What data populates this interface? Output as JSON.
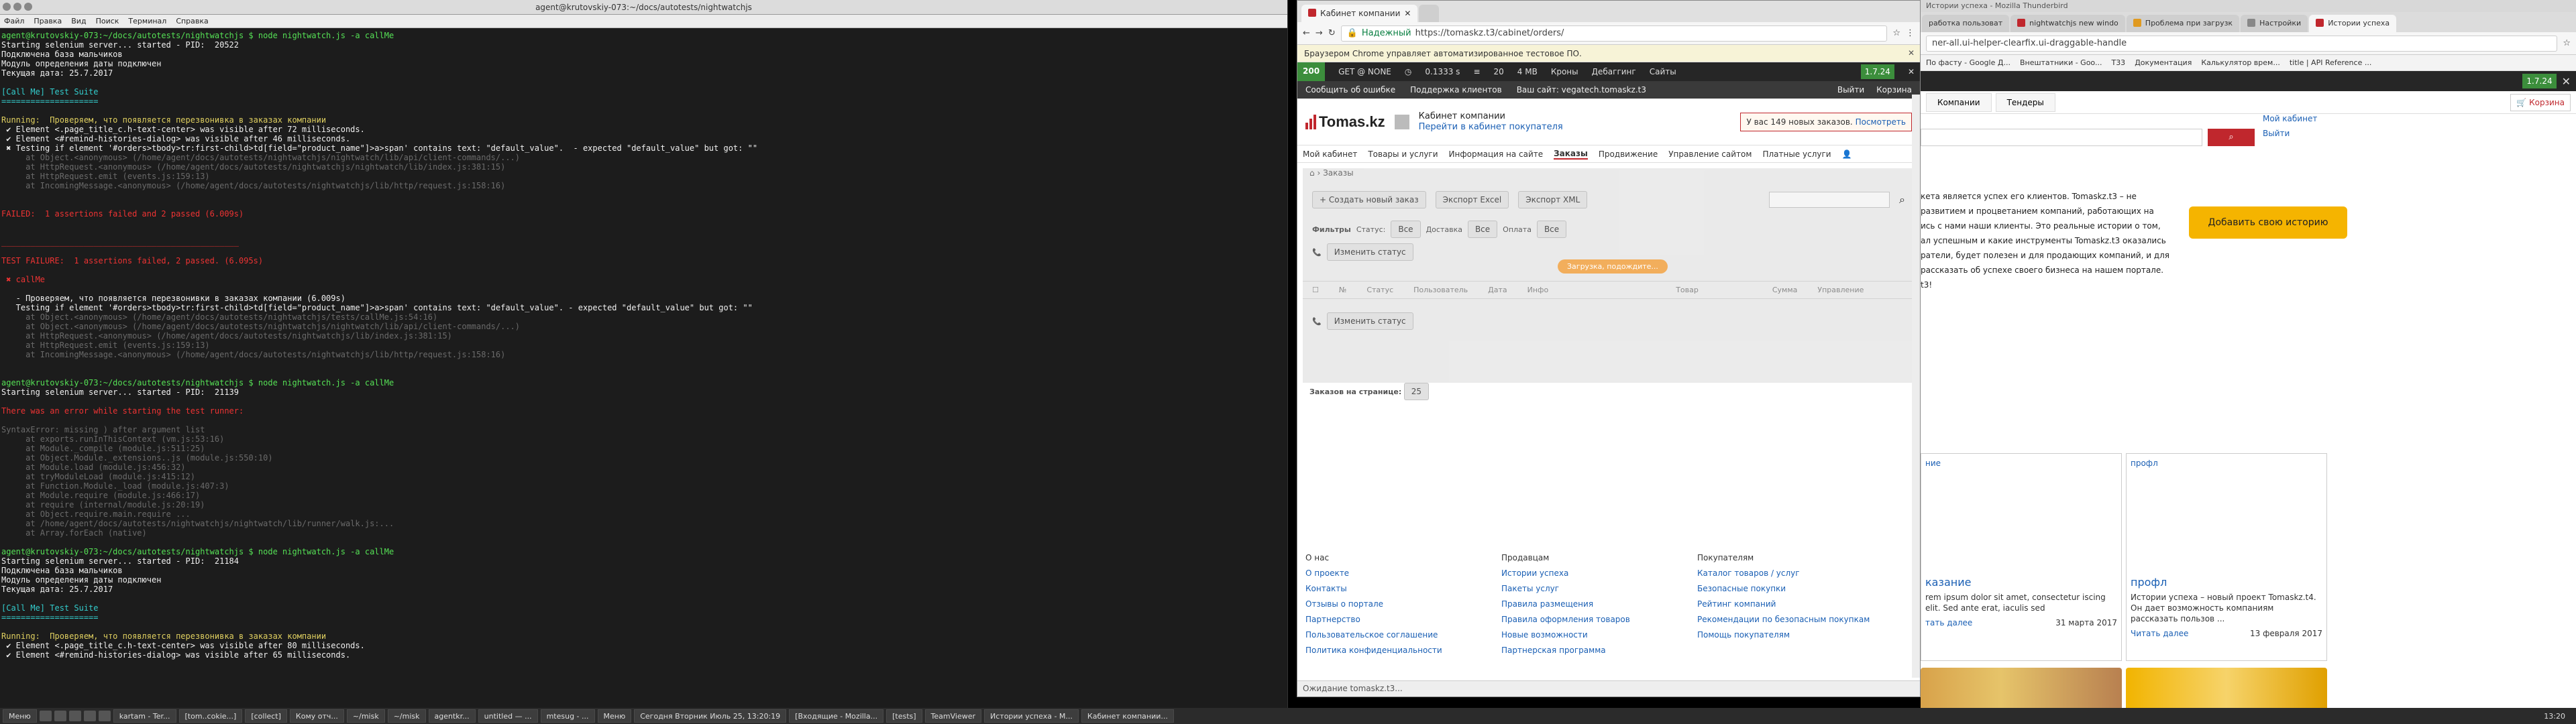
{
  "terminal": {
    "title": "agent@krutovskiy-073:~/docs/autotests/nightwatchjs",
    "menu": [
      "Файл",
      "Правка",
      "Вид",
      "Поиск",
      "Терминал",
      "Справка"
    ],
    "lines": [
      {
        "t": "agent@krutovskiy-073:~/docs/autotests/nightwatchjs $ node nightwatch.js -a callMe",
        "c": "cg"
      },
      {
        "t": "Starting selenium server... started - PID:  20522",
        "c": "cw"
      },
      {
        "t": "Подключена база мальчиков",
        "c": "cw"
      },
      {
        "t": "Модуль определения даты подключен",
        "c": "cw"
      },
      {
        "t": "Текущая дата: 25.7.2017",
        "c": "cw"
      },
      {
        "t": "",
        "c": "cw"
      },
      {
        "t": "[Call Me] Test Suite",
        "c": "cc"
      },
      {
        "t": "====================",
        "c": "cc"
      },
      {
        "t": "",
        "c": "cw"
      },
      {
        "t": "Running:  Проверяем, что появляется перезвонивка в заказах компании",
        "c": "cy"
      },
      {
        "t": " ✔ Element <.page_title_c.h-text-center> was visible after 72 milliseconds.",
        "c": "cw"
      },
      {
        "t": " ✔ Element <#remind-histories-dialog> was visible after 46 milliseconds.",
        "c": "cw"
      },
      {
        "t": " ✖ Testing if element '#orders>tbody>tr:first-child>td[field=\"product_name\"]>a>span' contains text: \"default_value\".  - expected \"default_value\" but got: \"\"",
        "c": "cw"
      },
      {
        "t": "     at Object.<anonymous> (/home/agent/docs/autotests/nightwatchjs/nightwatch/lib/api/client-commands/...)",
        "c": "cd"
      },
      {
        "t": "     at HttpRequest.<anonymous> (/home/agent/docs/autotests/nightwatchjs/nightwatch/lib/index.js:381:15)",
        "c": "cd"
      },
      {
        "t": "     at HttpRequest.emit (events.js:159:13)",
        "c": "cd"
      },
      {
        "t": "     at IncomingMessage.<anonymous> (/home/agent/docs/autotests/nightwatchjs/lib/http/request.js:158:16)",
        "c": "cd"
      },
      {
        "t": "",
        "c": "cw"
      },
      {
        "t": "",
        "c": "cw"
      },
      {
        "t": "FAILED:  1 assertions failed and 2 passed (6.009s)",
        "c": "cr"
      },
      {
        "t": "",
        "c": "cw"
      },
      {
        "t": "",
        "c": "cw"
      },
      {
        "t": "_________________________________________________",
        "c": "cr"
      },
      {
        "t": "",
        "c": "cw"
      },
      {
        "t": "TEST FAILURE:  1 assertions failed, 2 passed. (6.095s)",
        "c": "cr"
      },
      {
        "t": "",
        "c": "cw"
      },
      {
        "t": " ✖ callMe",
        "c": "cr"
      },
      {
        "t": "",
        "c": "cw"
      },
      {
        "t": "   - Проверяем, что появляется перезвонивки в заказах компании (6.009s)",
        "c": "cw"
      },
      {
        "t": "   Testing if element '#orders>tbody>tr:first-child>td[field=\"product_name\"]>a>span' contains text: \"default_value\". - expected \"default_value\" but got: \"\"",
        "c": "cw"
      },
      {
        "t": "     at Object.<anonymous> (/home/agent/docs/autotests/nightwatchjs/tests/callMe.js:54:16)",
        "c": "cd"
      },
      {
        "t": "     at Object.<anonymous> (/home/agent/docs/autotests/nightwatchjs/nightwatch/lib/api/client-commands/...)",
        "c": "cd"
      },
      {
        "t": "     at HttpRequest.<anonymous> (/home/agent/docs/autotests/nightwatchjs/lib/index.js:381:15)",
        "c": "cd"
      },
      {
        "t": "     at HttpRequest.emit (events.js:159:13)",
        "c": "cd"
      },
      {
        "t": "     at IncomingMessage.<anonymous> (/home/agent/docs/autotests/nightwatchjs/lib/http/request.js:158:16)",
        "c": "cd"
      },
      {
        "t": "",
        "c": "cw"
      },
      {
        "t": "",
        "c": "cw"
      },
      {
        "t": "agent@krutovskiy-073:~/docs/autotests/nightwatchjs $ node nightwatch.js -a callMe",
        "c": "cg"
      },
      {
        "t": "Starting selenium server... started - PID:  21139",
        "c": "cw"
      },
      {
        "t": "",
        "c": "cw"
      },
      {
        "t": "There was an error while starting the test runner:",
        "c": "cr"
      },
      {
        "t": "",
        "c": "cw"
      },
      {
        "t": "SyntaxError: missing ) after argument list",
        "c": "cd"
      },
      {
        "t": "     at exports.runInThisContext (vm.js:53:16)",
        "c": "cd"
      },
      {
        "t": "     at Module._compile (module.js:511:25)",
        "c": "cd"
      },
      {
        "t": "     at Object.Module._extensions..js (module.js:550:10)",
        "c": "cd"
      },
      {
        "t": "     at Module.load (module.js:456:32)",
        "c": "cd"
      },
      {
        "t": "     at tryModuleLoad (module.js:415:12)",
        "c": "cd"
      },
      {
        "t": "     at Function.Module._load (module.js:407:3)",
        "c": "cd"
      },
      {
        "t": "     at Module.require (module.js:466:17)",
        "c": "cd"
      },
      {
        "t": "     at require (internal/module.js:20:19)",
        "c": "cd"
      },
      {
        "t": "     at Object.require.main.require ...",
        "c": "cd"
      },
      {
        "t": "     at /home/agent/docs/autotests/nightwatchjs/nightwatch/lib/runner/walk.js:...",
        "c": "cd"
      },
      {
        "t": "     at Array.forEach (native)",
        "c": "cd"
      },
      {
        "t": "",
        "c": "cw"
      },
      {
        "t": "agent@krutovskiy-073:~/docs/autotests/nightwatchjs $ node nightwatch.js -a callMe",
        "c": "cg"
      },
      {
        "t": "Starting selenium server... started - PID:  21184",
        "c": "cw"
      },
      {
        "t": "Подключена база мальчиков",
        "c": "cw"
      },
      {
        "t": "Модуль определения даты подключен",
        "c": "cw"
      },
      {
        "t": "Текущая дата: 25.7.2017",
        "c": "cw"
      },
      {
        "t": "",
        "c": "cw"
      },
      {
        "t": "[Call Me] Test Suite",
        "c": "cc"
      },
      {
        "t": "====================",
        "c": "cc"
      },
      {
        "t": "",
        "c": "cw"
      },
      {
        "t": "Running:  Проверяем, что появляется перезвонивка в заказах компании",
        "c": "cy"
      },
      {
        "t": " ✔ Element <.page_title_c.h-text-center> was visible after 80 milliseconds.",
        "c": "cw"
      },
      {
        "t": " ✔ Element <#remind-histories-dialog> was visible after 65 milliseconds.",
        "c": "cw"
      }
    ]
  },
  "browser1": {
    "tabs": [
      "Кабинет компании",
      ""
    ],
    "secure": "Надежный",
    "url": "https://tomaskz.t3/cabinet/orders/",
    "infobar": "Браузером Chrome управляет автоматизированное тестовое ПО.",
    "debug": {
      "code": "200",
      "method": "GET @ NONE",
      "time": "0.1333 s",
      "count": "20",
      "mem": "4 MB",
      "crons": "Кроны",
      "debugging": "Дебаггинг",
      "sites": "Сайты",
      "version": "1.7.24"
    },
    "topnav": [
      "Сообщить об ошибке",
      "Поддержка клиентов",
      "Ваш сайт: vegatech.tomaskz.t3"
    ],
    "logout": "Выйти",
    "cart": "Корзина",
    "logo": "Tomas.kz",
    "cabinet_title": "Кабинет компании",
    "cabinet_link": "Перейти в кабинет покупателя",
    "orders_notice": "У вас 149 новых заказов.",
    "orders_link": "Посмотреть",
    "mainnav": [
      "Мой кабинет",
      "Товары и услуги",
      "Информация на сайте",
      "Заказы",
      "Продвижение",
      "Управление сайтом",
      "Платные услуги"
    ],
    "crumb": "Заказы",
    "buttons": [
      "Создать новый заказ",
      "Экспорт Excel",
      "Экспорт XML"
    ],
    "filters": {
      "label": "Фильтры",
      "status": "Статус:",
      "all": "Все",
      "delivery": "Доставка",
      "payment": "Оплата"
    },
    "loading": "Загрузка, подождите...",
    "change_status": "Изменить статус",
    "columns": [
      "№",
      "Статус",
      "Пользователь",
      "Дата",
      "Инфо",
      "Товар",
      "Сумма",
      "Управление"
    ],
    "per_page_label": "Заказов на странице:",
    "per_page": "25",
    "footer": [
      {
        "title": "О нас",
        "links": [
          "О проекте",
          "Контакты",
          "Отзывы о портале",
          "Партнерство",
          "Пользовательское соглашение",
          "Политика конфиденциальности"
        ]
      },
      {
        "title": "Продавцам",
        "links": [
          "Истории успеха",
          "Пакеты услуг",
          "Правила размещения",
          "Правила оформления товаров",
          "Новые возможности",
          "Партнерская программа"
        ]
      },
      {
        "title": "Покупателям",
        "links": [
          "Каталог товаров / услуг",
          "Безопасные покупки",
          "Рейтинг компаний",
          "Рекомендации по безопасным покупкам",
          "Помощь покупателям"
        ]
      }
    ],
    "status": "Ожидание tomaskz.t3..."
  },
  "browser2": {
    "title": "Истории успеха - Mozilla Thunderbird",
    "tabs": [
      "работка пользоват",
      "nightwatchjs new windo",
      "Проблема при загрузк",
      "Настройки",
      "Истории успеха"
    ],
    "url": "ner-all.ui-helper-clearfix.ui-draggable-handle",
    "bookmarks": [
      "По фасту - Google Д...",
      "Внештатники - Goo...",
      "T33",
      "Документация",
      "Калькулятор врем...",
      "title | API Reference ..."
    ],
    "version": "1.7.24",
    "subtabs": [
      "Компании",
      "Тендеры"
    ],
    "cart": "Корзина",
    "toplinks": [
      "Мой кабинет",
      "Выйти"
    ],
    "intro": [
      "кета является успех его клиентов. Tomaskz.t3 – не",
      "развитием и процветанием компаний, работающих на",
      "",
      "ись с нами наши клиенты. Это реальные истории о том,",
      "ал успешным и какие инструменты Tomaskz.t3 оказались",
      "",
      "ратели, будет полезен и для продающих компаний, и для",
      "рассказать об успехе своего бизнеса на нашем портале.",
      "t3!"
    ],
    "add_story": "Добавить свою историю",
    "card1": {
      "tag": "ние",
      "title": "казание",
      "text": "rem ipsum dolor sit amet, consectetur iscing elit. Sed ante erat, iaculis sed",
      "read": "тать далее",
      "date": "31 марта 2017"
    },
    "card2": {
      "tag": "профл",
      "title": "профл",
      "text": "Истории успеха – новый проект Tomaskz.t4. Он дает возможность компаниям рассказать пользов ...",
      "read": "Читать далее",
      "date": "13 февраля 2017"
    }
  },
  "taskbar": {
    "menu": "Меню",
    "items": [
      "kartam - Ter...",
      "[tom..cokie...]",
      "[collect]",
      "Кому отч...",
      "~/misk",
      "~/misk",
      "agentkr...",
      "untitled — ...",
      "mtesug - ...",
      "Меню",
      "Сегодня Вторник Июль 25, 13:20:19",
      "[Входящие - Mozilla...",
      "[tests]",
      "TeamViewer",
      "Истории успеха - M...",
      "Кабинет компании..."
    ],
    "clock": "13:20"
  }
}
